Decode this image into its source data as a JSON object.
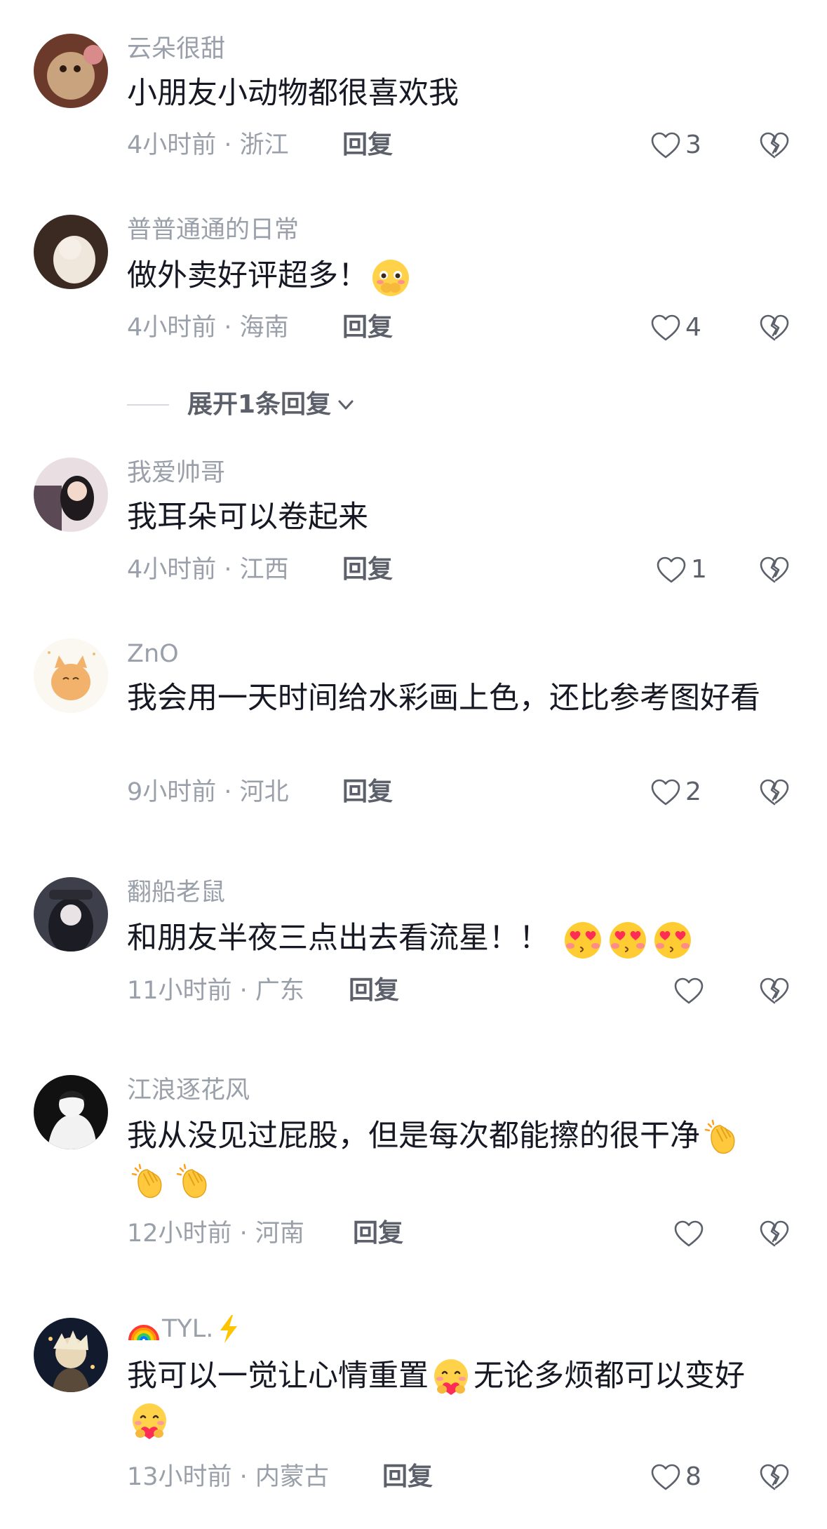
{
  "comments": [
    {
      "username": "云朵很甜",
      "text": "小朋友小动物都很喜欢我",
      "time_location": "4小时前 · 浙江",
      "reply_label": "回复",
      "likes": "3"
    },
    {
      "username": "普普通通的日常",
      "text": "做外卖好评超多！",
      "time_location": "4小时前 · 海南",
      "reply_label": "回复",
      "likes": "4"
    },
    {
      "username": "我爱帅哥",
      "text": "我耳朵可以卷起来",
      "time_location": "4小时前 · 江西",
      "reply_label": "回复",
      "likes": "1"
    },
    {
      "username": "ZnO",
      "text": "我会用一天时间给水彩画上色，还比参考图好看",
      "time_location": "9小时前 · 河北",
      "reply_label": "回复",
      "likes": "2"
    },
    {
      "username": "翻船老鼠",
      "text": "和朋友半夜三点出去看流星！！",
      "time_location": "11小时前 · 广东",
      "reply_label": "回复",
      "likes": ""
    },
    {
      "username": "江浪逐花风",
      "text": "我从没见过屁股，但是每次都能擦的很干净",
      "time_location": "12小时前 · 河南",
      "reply_label": "回复",
      "likes": ""
    },
    {
      "username": "TYL.",
      "text_part1": "我可以一觉让心情重置",
      "text_part2": "无论多烦都可以变好",
      "time_location": "13小时前 · 内蒙古",
      "reply_label": "回复",
      "likes": "8"
    }
  ],
  "expand_replies": {
    "label": "展开1条回复"
  },
  "icons": {
    "like": "heart-outline-icon",
    "dislike": "broken-heart-icon",
    "expand": "chevron-down-icon",
    "emojis": [
      "shy-covering-mouth-emoji",
      "heart-eyes-emoji",
      "clapping-hands-emoji",
      "hugging-heart-emoji",
      "rainbow-emoji",
      "lightning-emoji"
    ]
  },
  "colors": {
    "username": "#9aa0aa",
    "content": "#161823",
    "secondary": "#5c606a",
    "background": "#ffffff"
  }
}
